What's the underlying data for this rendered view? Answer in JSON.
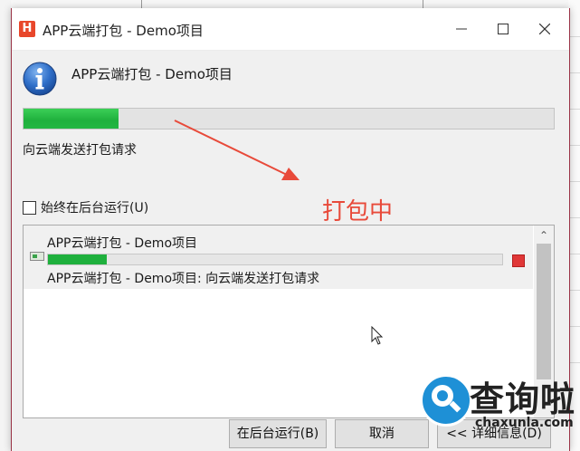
{
  "window": {
    "app_icon_letter": "H",
    "title": "APP云端打包 - Demo项目",
    "accent_color": "#9a3346"
  },
  "header": {
    "title": "APP云端打包 - Demo项目",
    "icon": "info-icon"
  },
  "main_progress": {
    "percent": 18,
    "color": "#1fb03d"
  },
  "status_text": "向云端发送打包请求",
  "annotation": {
    "text": "打包中",
    "color": "#e84a3a"
  },
  "checkbox": {
    "label": "始终在后台运行(U)",
    "checked": false
  },
  "task": {
    "name": "APP云端打包 - Demo项目",
    "progress_percent": 13,
    "detail": "APP云端打包 - Demo项目: 向云端发送打包请求"
  },
  "buttons": {
    "background": "在后台运行(B)",
    "cancel": "取消",
    "details": "<< 详细信息(D)"
  },
  "watermark": {
    "brand": "查询啦",
    "url": "chaxunla.com"
  }
}
